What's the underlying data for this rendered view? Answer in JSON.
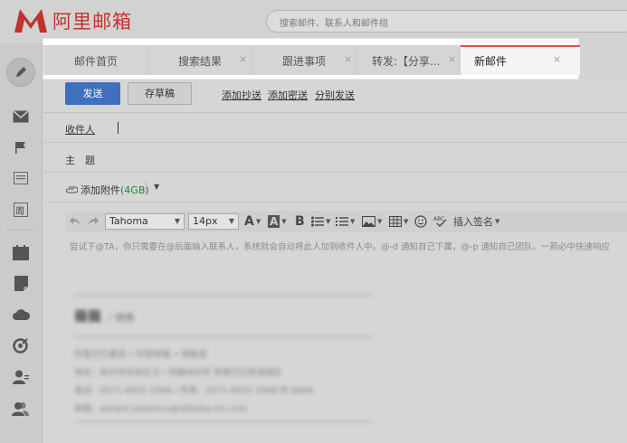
{
  "brand": {
    "logo_text": "阿里邮箱",
    "color": "#c0332e"
  },
  "search": {
    "placeholder": "搜索邮件、联系人和邮件组"
  },
  "sidebar": {
    "items": [
      {
        "icon": "pencil-icon"
      },
      {
        "icon": "envelope-icon"
      },
      {
        "icon": "flag-icon"
      },
      {
        "icon": "message-icon"
      },
      {
        "icon": "calendar-week-icon",
        "label": "周"
      },
      {
        "icon": "calendar-icon"
      },
      {
        "icon": "note-icon"
      },
      {
        "icon": "cloud-icon"
      },
      {
        "icon": "target-icon"
      },
      {
        "icon": "contacts-icon"
      },
      {
        "icon": "group-icon"
      }
    ]
  },
  "tabs": [
    {
      "label": "邮件首页",
      "closable": false
    },
    {
      "label": "搜索结果",
      "closable": true
    },
    {
      "label": "跟进事项",
      "closable": true
    },
    {
      "label": "转发:【分享...",
      "closable": true
    },
    {
      "label": "新邮件",
      "closable": true,
      "active": true
    }
  ],
  "tab_close_glyph": "×",
  "compose": {
    "send_label": "发送",
    "draft_label": "存草稿",
    "add_cc": "添加抄送",
    "add_bcc": "添加密送",
    "separate_send": "分别发送",
    "to_label": "收件人",
    "subject_label": "主　题",
    "attach_label": "添加附件",
    "attach_size": "(4GB)",
    "attach_dropdown": "▼",
    "accent": "#3f6fbe"
  },
  "editor": {
    "font": "Tahoma",
    "size": "14px",
    "text_color_glyph": "A",
    "bg_color_glyph": "A",
    "bold_glyph": "B",
    "insert_signature": "插入签名",
    "hint": "尝试下@TA，你只需要在@后面输入联系人，系统就会自动将此人加到收件人中。@-d 通知自己下属，@-p 通知自己团队。一箭必中快速响应"
  },
  "signature": {
    "name": "薇薇",
    "role": "/ 销售",
    "lines": [
      "阿里巴巴集团 • 阿里邮箱 • 销售部",
      "地址：杭州市余杭区文一西路969号 阿里巴巴西溪园区",
      "电话：0571-8502 2088 / 传真：0571-8502 2088 转 8888",
      "邮箱：weiwei.xiaoshou@alibaba-inc.com"
    ]
  }
}
